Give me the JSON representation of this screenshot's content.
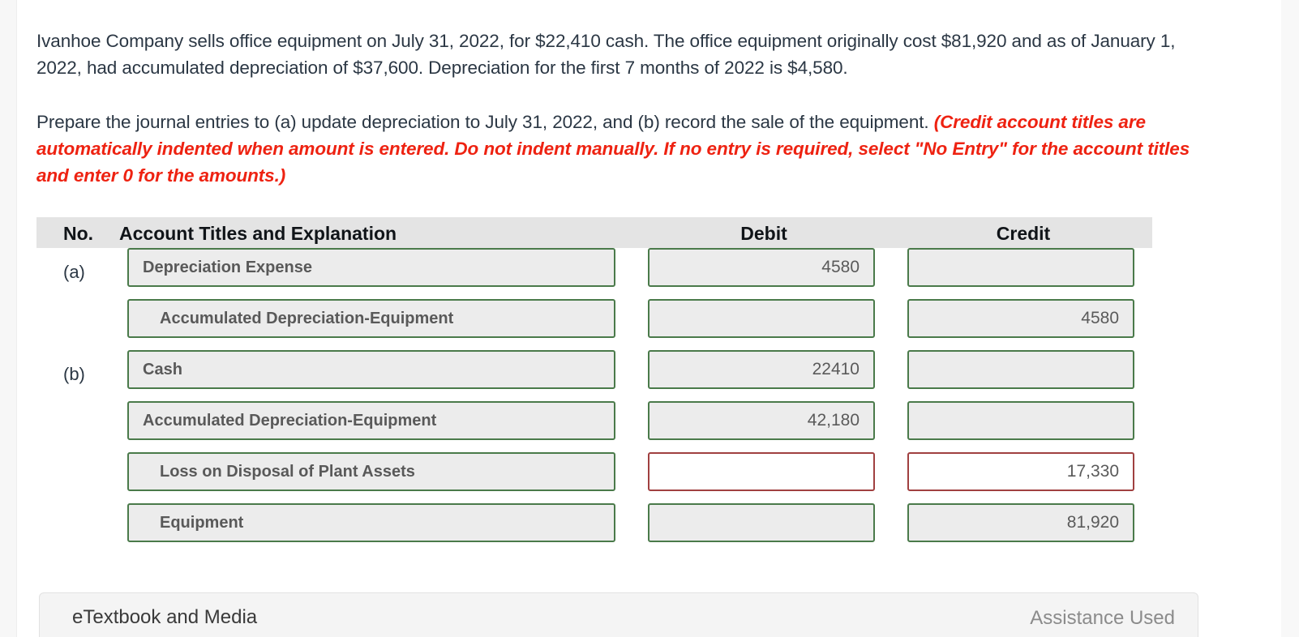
{
  "statement": {
    "text": "Ivanhoe Company sells office equipment on July 31, 2022, for $22,410 cash. The office equipment originally cost $81,920 and as of January 1, 2022, had accumulated depreciation of $37,600. Depreciation for the first 7 months of 2022 is $4,580."
  },
  "instruction": {
    "lead": "Prepare the journal entries to (a) update depreciation to July 31, 2022, and (b) record the sale of the equipment.",
    "hint": "(Credit account titles are automatically indented when amount is entered. Do not indent manually. If no entry is required, select \"No Entry\" for the account titles and enter 0 for the amounts.)"
  },
  "table": {
    "headers": {
      "no": "No.",
      "account": "Account Titles and Explanation",
      "debit": "Debit",
      "credit": "Credit"
    },
    "rows": [
      {
        "no": "(a)",
        "account": "Depreciation Expense",
        "account_indent": false,
        "account_state": "normal",
        "debit": "4580",
        "debit_state": "normal",
        "credit": "",
        "credit_state": "normal"
      },
      {
        "no": "",
        "account": "Accumulated Depreciation-Equipment",
        "account_indent": true,
        "account_state": "normal",
        "debit": "",
        "debit_state": "normal",
        "credit": "4580",
        "credit_state": "normal"
      },
      {
        "no": "(b)",
        "account": "Cash",
        "account_indent": false,
        "account_state": "normal",
        "debit": "22410",
        "debit_state": "normal",
        "credit": "",
        "credit_state": "normal"
      },
      {
        "no": "",
        "account": "Accumulated Depreciation-Equipment",
        "account_indent": false,
        "account_state": "normal",
        "debit": "42,180",
        "debit_state": "normal",
        "credit": "",
        "credit_state": "normal"
      },
      {
        "no": "",
        "account": "Loss on Disposal of Plant Assets",
        "account_indent": true,
        "account_state": "normal",
        "debit": "",
        "debit_state": "error",
        "credit": "17,330",
        "credit_state": "error"
      },
      {
        "no": "",
        "account": "Equipment",
        "account_indent": true,
        "account_state": "normal",
        "debit": "",
        "debit_state": "normal",
        "credit": "81,920",
        "credit_state": "normal"
      }
    ]
  },
  "footer": {
    "etextbook_label": "eTextbook and Media",
    "assistance_label": "Assistance Used"
  },
  "colors": {
    "valid_border": "#4a7a4a",
    "error_border": "#a04040",
    "field_fill": "#ececec",
    "header_fill": "#e4e4e4",
    "hint_red": "#ee2211",
    "body_text": "#2b3744"
  }
}
